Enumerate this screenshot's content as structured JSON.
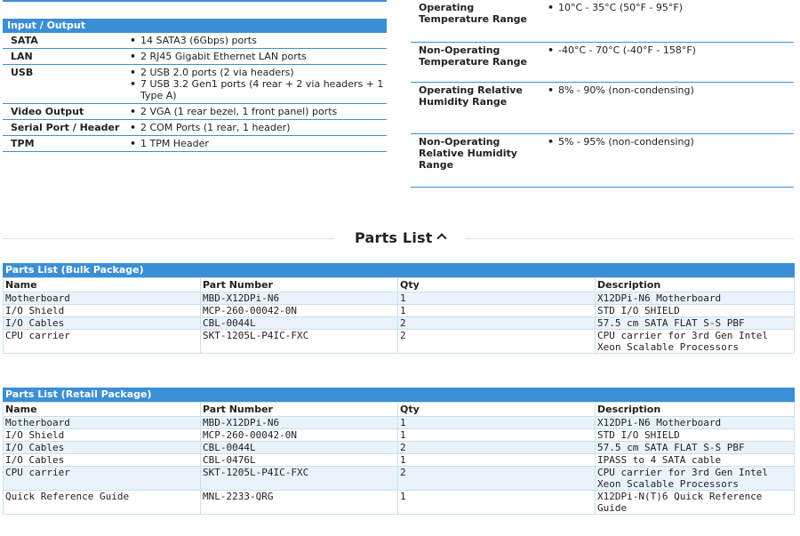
{
  "io_section": {
    "header": "Input / Output",
    "rows": [
      {
        "label": "SATA",
        "values": [
          "14 SATA3 (6Gbps) ports"
        ]
      },
      {
        "label": "LAN",
        "values": [
          "2 RJ45 Gigabit Ethernet LAN ports"
        ]
      },
      {
        "label": "USB",
        "values": [
          "2 USB 2.0 ports (2 via headers)",
          "7 USB 3.2 Gen1 ports (4 rear + 2 via headers + 1 Type A)"
        ]
      },
      {
        "label": "Video Output",
        "values": [
          "2 VGA (1 rear bezel, 1 front panel) ports"
        ]
      },
      {
        "label": "Serial Port / Header",
        "values": [
          "2 COM Ports (1 rear, 1 header)"
        ]
      },
      {
        "label": "TPM",
        "values": [
          "1 TPM Header"
        ]
      }
    ]
  },
  "env_section": {
    "rows": [
      {
        "label": "Operating Temperature Range",
        "values": [
          "10°C - 35°C (50°F - 95°F)"
        ]
      },
      {
        "label": "Non-Operating Temperature Range",
        "values": [
          "-40°C - 70°C (-40°F - 158°F)"
        ]
      },
      {
        "label": "Operating Relative Humidity Range",
        "values": [
          "8% - 90% (non-condensing)"
        ]
      },
      {
        "label": "Non-Operating Relative Humidity Range",
        "values": [
          "5% - 95% (non-condensing)"
        ]
      }
    ]
  },
  "parts_list": {
    "title": "Parts List",
    "columns": [
      "Name",
      "Part Number",
      "Qty",
      "Description"
    ],
    "bulk": {
      "caption": "Parts List (Bulk Package)",
      "rows": [
        [
          "Motherboard",
          "MBD-X12DPi-N6",
          "1",
          "X12DPi-N6 Motherboard"
        ],
        [
          "I/O Shield",
          "MCP-260-00042-0N",
          "1",
          "STD I/O SHIELD"
        ],
        [
          "I/O Cables",
          "CBL-0044L",
          "2",
          "57.5 cm SATA FLAT S-S PBF"
        ],
        [
          "CPU carrier",
          "SKT-1205L-P4IC-FXC",
          "2",
          "CPU carrier for 3rd Gen Intel Xeon Scalable Processors"
        ]
      ]
    },
    "retail": {
      "caption": "Parts List (Retail Package)",
      "rows": [
        [
          "Motherboard",
          "MBD-X12DPi-N6",
          "1",
          "X12DPi-N6 Motherboard"
        ],
        [
          "I/O Shield",
          "MCP-260-00042-0N",
          "1",
          "STD I/O SHIELD"
        ],
        [
          "I/O Cables",
          "CBL-0044L",
          "2",
          "57.5 cm SATA FLAT S-S PBF"
        ],
        [
          "I/O Cables",
          "CBL-0476L",
          "1",
          "IPASS to 4 SATA cable"
        ],
        [
          "CPU carrier",
          "SKT-1205L-P4IC-FXC",
          "2",
          "CPU carrier for 3rd Gen Intel Xeon Scalable Processors"
        ],
        [
          "Quick Reference Guide",
          "MNL-2233-QRG",
          "1",
          "X12DPi-N(T)6 Quick Reference Guide"
        ]
      ]
    }
  },
  "icons": {
    "collapse": "chevron-up-icon",
    "bullet": "bullet-icon"
  },
  "colors": {
    "accent": "#3b8fd6",
    "row_alt": "#eaf3fb",
    "border": "#c9dff0"
  }
}
